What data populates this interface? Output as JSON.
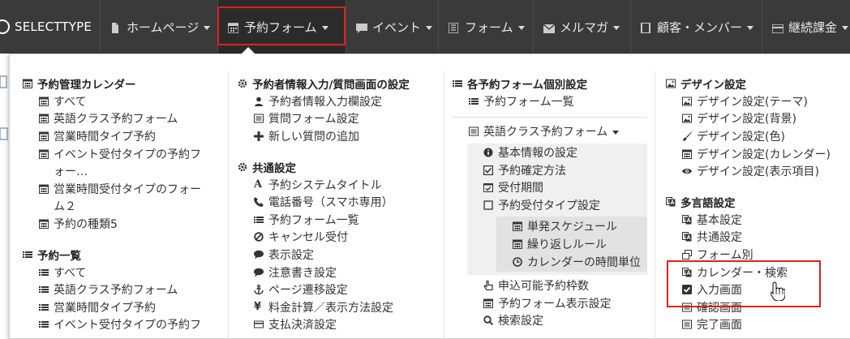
{
  "brand": "SELECTTYPE",
  "nav": [
    {
      "label": "ホームページ",
      "icon": "file-icon"
    },
    {
      "label": "予約フォーム",
      "icon": "calendar-icon"
    },
    {
      "label": "イベント",
      "icon": "comment-icon"
    },
    {
      "label": "フォーム",
      "icon": "list-icon"
    },
    {
      "label": "メルマガ",
      "icon": "envelope-icon"
    },
    {
      "label": "顧客・メンバー",
      "icon": "book-icon"
    },
    {
      "label": "継続課金",
      "icon": "credit-card-icon"
    }
  ],
  "col1": {
    "section1": {
      "title": "予約管理カレンダー"
    },
    "items1": [
      "すべて",
      "英語クラス予約フォーム",
      "営業時間タイプ予約",
      "イベント受付タイプの予約フ",
      "ォー…",
      "営業時間受付タイプのフォー",
      "ム２",
      "予約の種類5"
    ],
    "section2": {
      "title": "予約一覧"
    },
    "items2": [
      "すべて",
      "英語クラス予約フォーム",
      "営業時間タイプ予約",
      "イベント受付タイプの予約フ"
    ]
  },
  "col2": {
    "section1": {
      "title": "予約者情報入力/質問画面の設定"
    },
    "items1": [
      "予約者情報入力欄設定",
      "質問フォーム設定",
      "新しい質問の追加"
    ],
    "section2": {
      "title": "共通設定"
    },
    "items2": [
      "予約システムタイトル",
      "電話番号（スマホ専用）",
      "予約フォーム一覧",
      "キャンセル受付",
      "表示設定",
      "注意書き設定",
      "ページ遷移設定",
      "料金計算／表示方法設定",
      "支払決済設定"
    ]
  },
  "col3": {
    "section1": {
      "title": "各予約フォーム個別設定"
    },
    "list_label": "予約フォーム一覧",
    "form_label": "英語クラス予約フォーム",
    "sub1": [
      "基本情報の設定",
      "予約確定方法",
      "受付期間",
      "予約受付タイプ設定"
    ],
    "sub2": [
      "単発スケジュール",
      "繰り返しルール",
      "カレンダーの時間単位"
    ],
    "items3": [
      "申込可能予約枠数",
      "予約フォーム表示設定",
      "検索設定"
    ]
  },
  "col4": {
    "section1": {
      "title": "デザイン設定"
    },
    "items1": [
      "デザイン設定(テーマ)",
      "デザイン設定(背景)",
      "デザイン設定(色)",
      "デザイン設定(カレンダー)",
      "デザイン設定(表示項目)"
    ],
    "section2": {
      "title": "多言語設定"
    },
    "items2": [
      "基本設定",
      "共通設定",
      "フォーム別",
      "カレンダー・検索",
      "入力画面",
      "確認画面",
      "完了画面"
    ]
  },
  "colors": {
    "navbar": "#3a3a3a",
    "highlight": "#e02020",
    "submenu_bg": "#f0f0f0"
  }
}
